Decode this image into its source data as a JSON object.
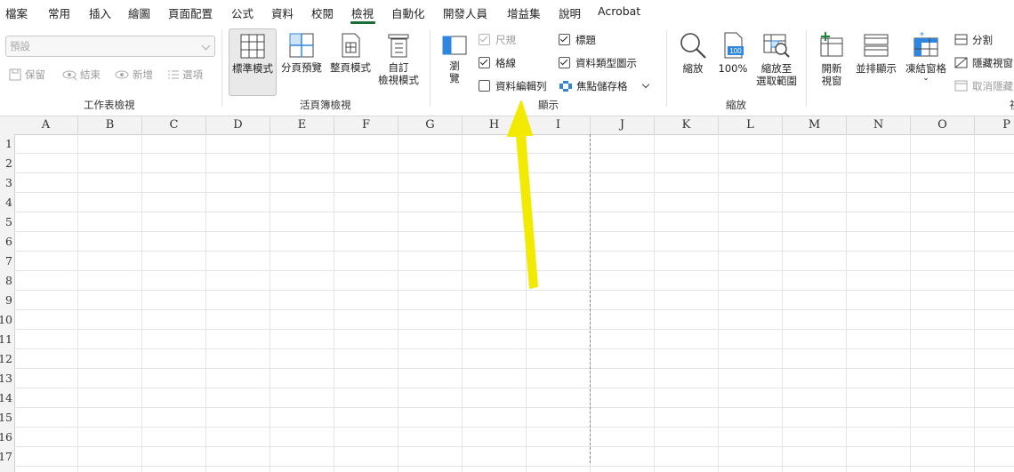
{
  "menu": {
    "tabs": [
      "檔案",
      "常用",
      "插入",
      "繪圖",
      "頁面配置",
      "公式",
      "資料",
      "校閱",
      "檢視",
      "自動化",
      "開發人員",
      "增益集",
      "說明",
      "Acrobat"
    ],
    "active": "檢視"
  },
  "ribbon": {
    "sheet_view": {
      "dropdown_value": "預設",
      "keep": "保留",
      "exit": "結束",
      "new": "新增",
      "options": "選項",
      "label": "工作表檢視"
    },
    "workbook_views": {
      "normal": "標準模式",
      "page_break": "分頁預覽",
      "page_layout": "整頁模式",
      "custom_line1": "自訂",
      "custom_line2": "檢視模式",
      "label": "活頁簿檢視"
    },
    "show": {
      "navigation_line1": "瀏",
      "navigation_line2": "覽",
      "ruler": "尺規",
      "gridlines": "格線",
      "formula_bar": "資料編輯列",
      "headings": "標題",
      "data_type_icons": "資料類型圖示",
      "focus_cell": "焦點儲存格",
      "label": "顯示",
      "ruler_checked": true,
      "gridlines_checked": true,
      "formula_bar_checked": false,
      "headings_checked": true,
      "data_type_icons_checked": true
    },
    "zoom": {
      "zoom": "縮放",
      "hundred": "100%",
      "zoom_sel_line1": "縮放至",
      "zoom_sel_line2": "選取範圍",
      "label": "縮放",
      "icon_text": "100"
    },
    "window": {
      "new_window_line1": "開新",
      "new_window_line2": "視窗",
      "arrange_all": "並排顯示",
      "freeze_panes": "凍結窗格",
      "split": "分割",
      "hide": "隱藏視窗",
      "unhide": "取消隱藏",
      "label_partial": "視"
    }
  },
  "sheet": {
    "columns": [
      "A",
      "B",
      "C",
      "D",
      "E",
      "F",
      "G",
      "H",
      "I",
      "J",
      "K",
      "L",
      "M",
      "N",
      "O",
      "P"
    ],
    "rows": [
      "1",
      "2",
      "3",
      "4",
      "5",
      "6",
      "7",
      "8",
      "9",
      "10",
      "11",
      "12",
      "13",
      "14",
      "15",
      "16",
      "17"
    ]
  },
  "colors": {
    "accent_green": "#1a6b3a",
    "arrow_yellow": "#f2ea00",
    "freeze_blue": "#2e86de"
  }
}
